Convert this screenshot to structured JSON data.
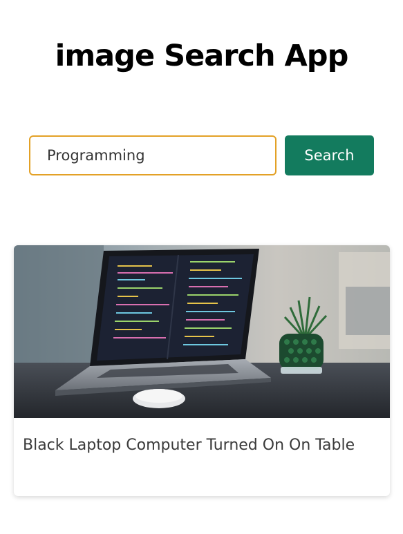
{
  "header": {
    "title": "image Search App"
  },
  "search": {
    "value": "Programming",
    "button_label": "Search"
  },
  "results": [
    {
      "caption": "Black Laptop Computer Turned On On Table"
    }
  ],
  "colors": {
    "accent_border": "#e3a126",
    "button_bg": "#137b5e"
  }
}
